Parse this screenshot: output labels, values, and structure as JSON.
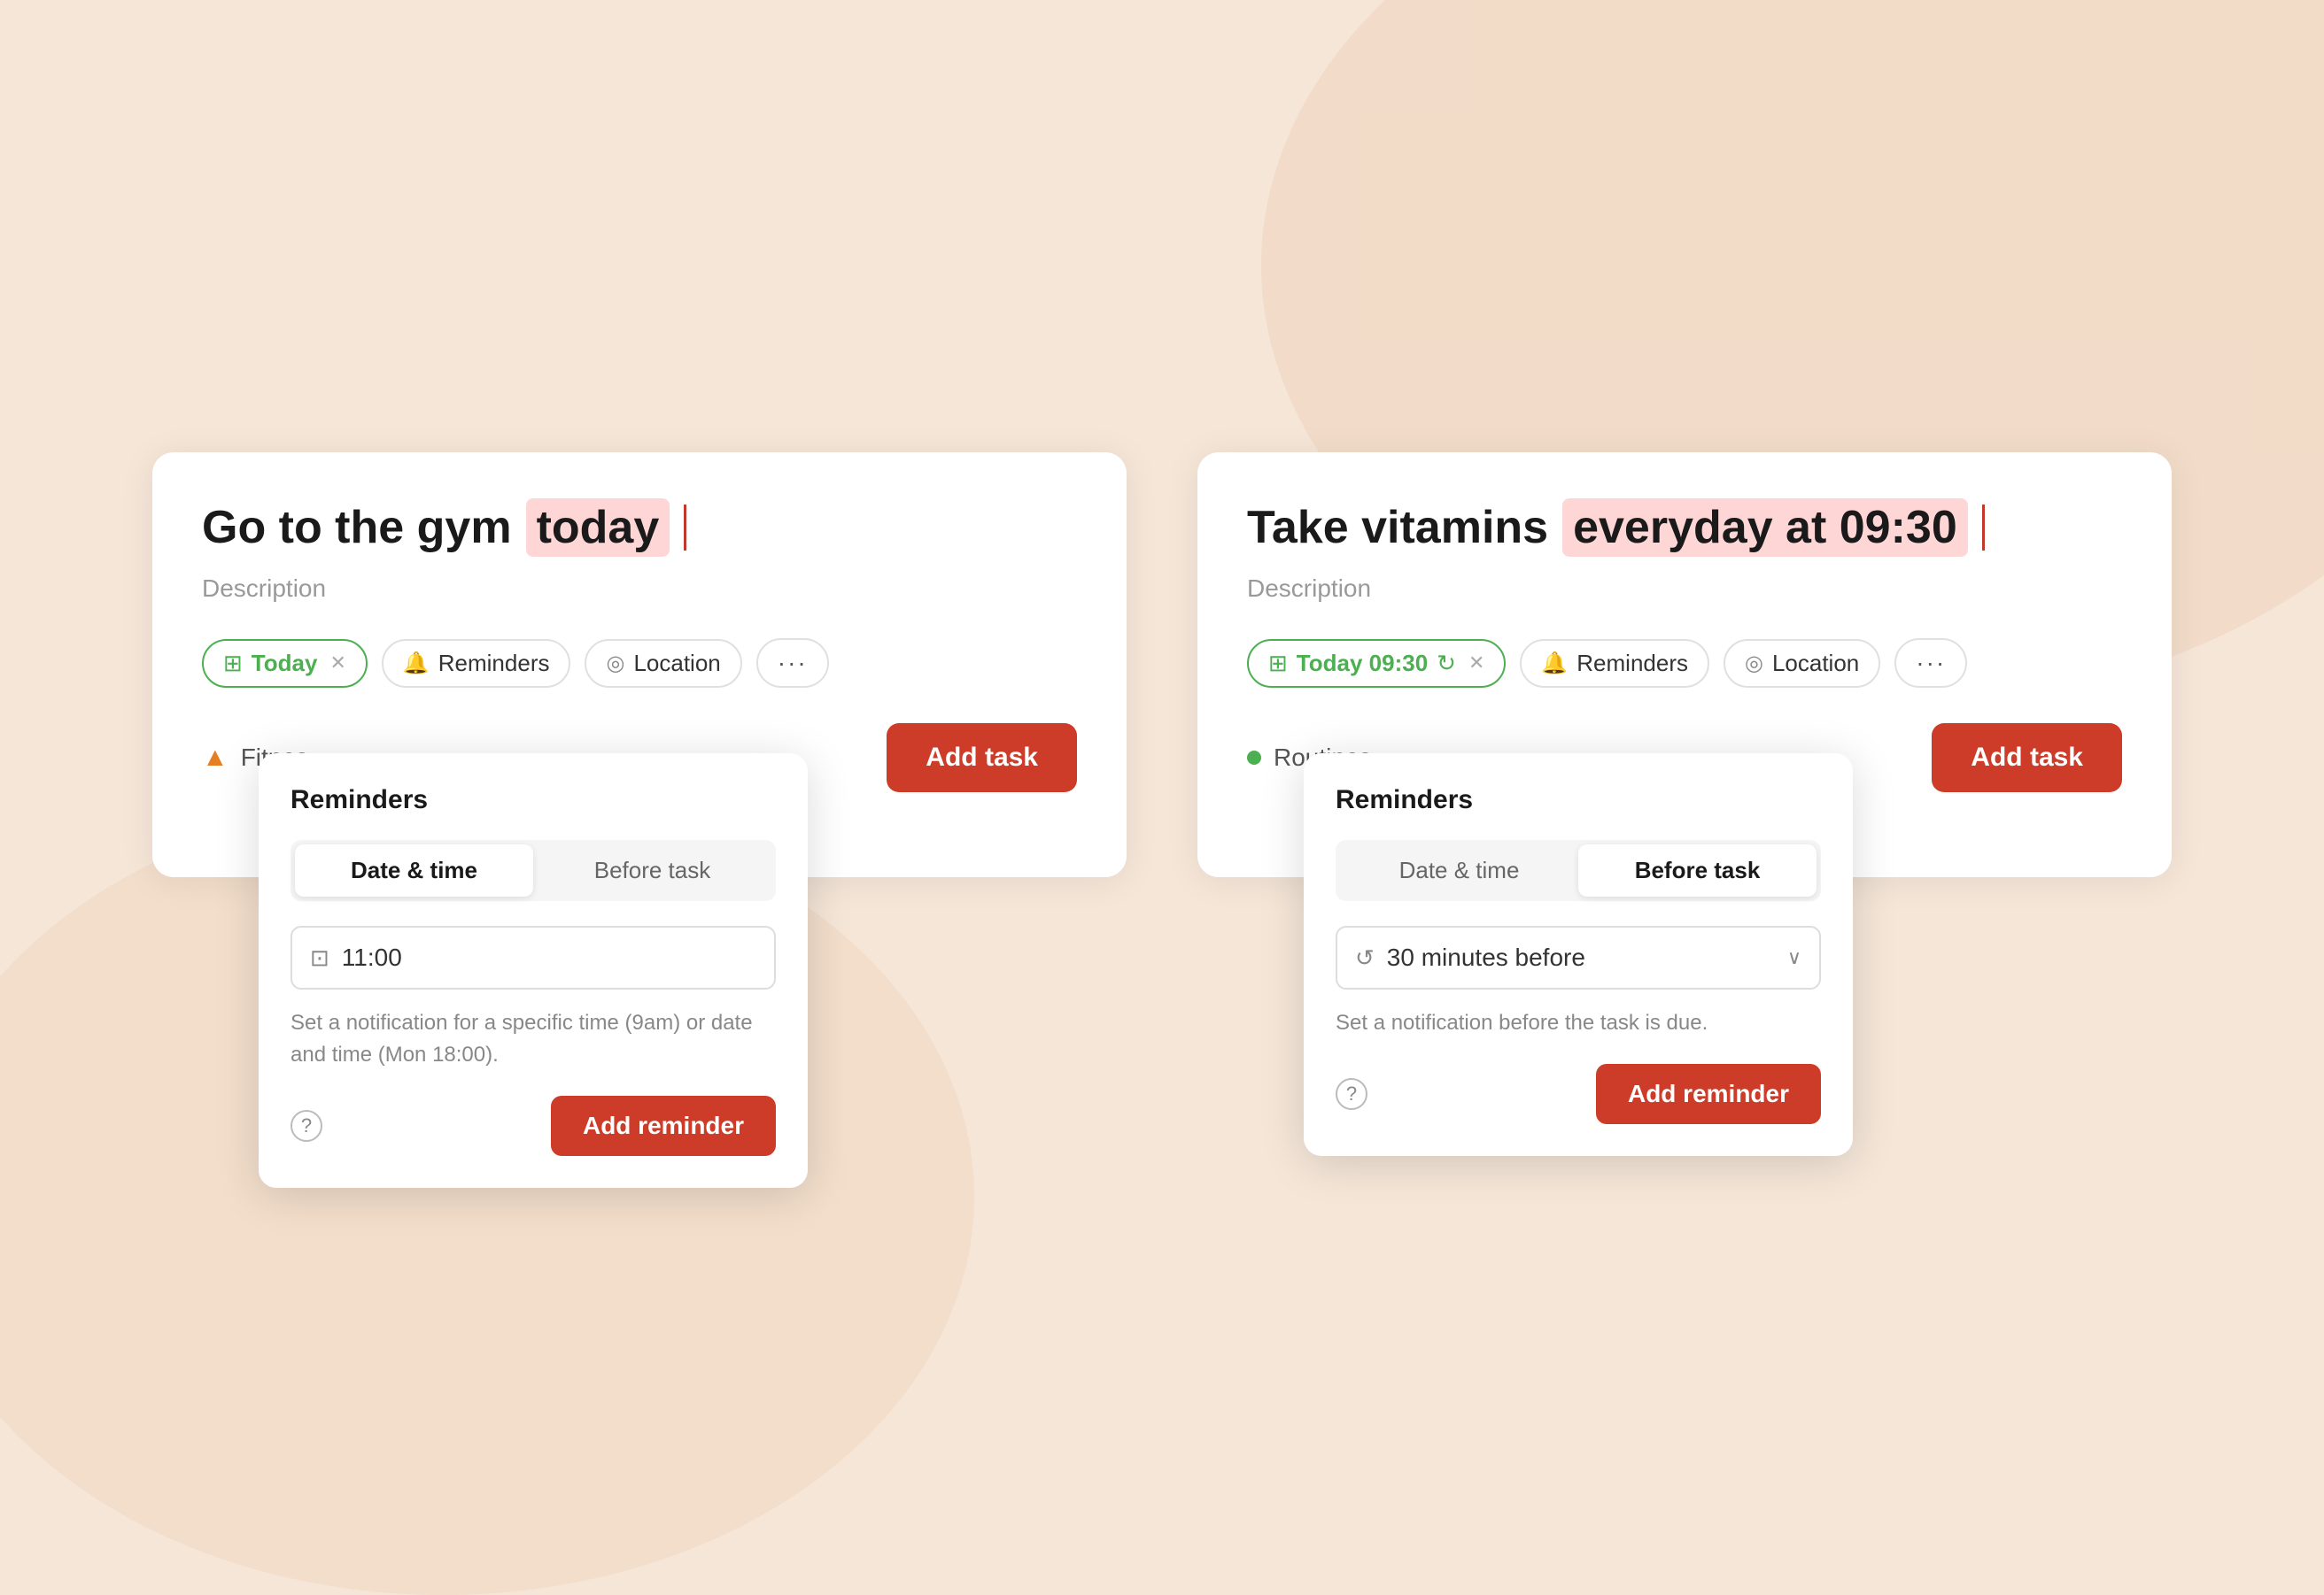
{
  "card1": {
    "title_prefix": "Go to the gym",
    "title_highlight": "today",
    "description": "Description",
    "tags": {
      "date": {
        "label": "Today",
        "icon": "📅"
      },
      "reminders": {
        "label": "Reminders"
      },
      "location": {
        "label": "Location"
      }
    },
    "footer": {
      "project": "Fitnes",
      "add_task_label": "Add task"
    },
    "popover": {
      "title": "Reminders",
      "tab1": "Date & time",
      "tab2": "Before task",
      "active_tab": "tab1",
      "time_value": "11:00",
      "hint": "Set a notification for a specific time (9am) or date and time (Mon 18:00).",
      "add_reminder_label": "Add reminder"
    }
  },
  "card2": {
    "title_prefix": "Take vitamins",
    "title_highlight": "everyday at 09:30",
    "description": "Description",
    "tags": {
      "date": {
        "label": "Today 09:30"
      },
      "reminders": {
        "label": "Reminders"
      },
      "location": {
        "label": "Location"
      }
    },
    "footer": {
      "project": "Routines",
      "add_task_label": "Add task"
    },
    "popover": {
      "title": "Reminders",
      "tab1": "Date & time",
      "tab2": "Before task",
      "active_tab": "tab2",
      "before_value": "30 minutes before",
      "hint": "Set a notification before the task is due.",
      "add_reminder_label": "Add reminder"
    }
  }
}
